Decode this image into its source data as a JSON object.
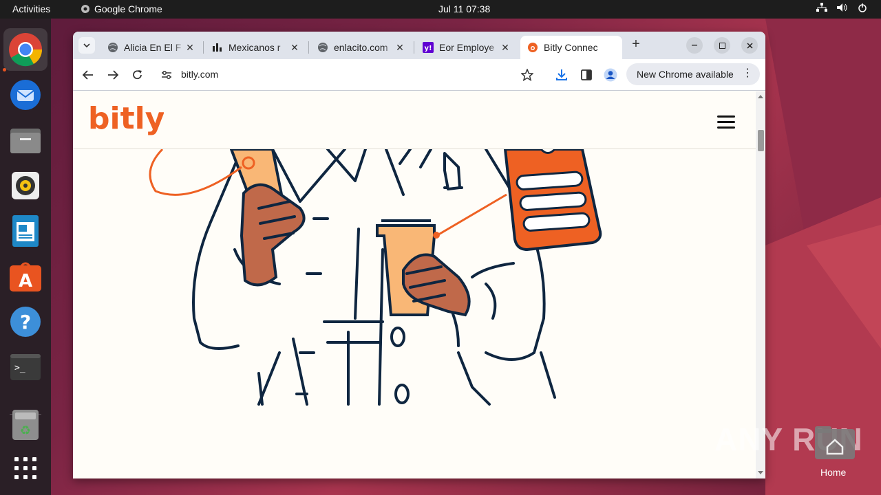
{
  "topbar": {
    "activities": "Activities",
    "app_name": "Google Chrome",
    "clock": "Jul 11  07:38"
  },
  "dock": {
    "items": [
      "chrome-icon",
      "thunderbird-icon",
      "files-icon",
      "rhythmbox-icon",
      "writer-icon",
      "app-center-icon",
      "help-icon",
      "terminal-icon",
      "trash-icon",
      "app-grid-icon"
    ]
  },
  "browser": {
    "tabs": [
      {
        "title": "Alicia En El F",
        "favicon": "globe-icon"
      },
      {
        "title": "Mexicanos r",
        "favicon": "site-icon"
      },
      {
        "title": "enlacito.com",
        "favicon": "globe-icon"
      },
      {
        "title": "Eor Employe",
        "favicon": "yahoo-icon"
      },
      {
        "title": "Bitly Connec",
        "favicon": "bitly-icon",
        "active": true
      }
    ],
    "url": "bitly.com",
    "update_label": "New Chrome available"
  },
  "page": {
    "logo_text": "bitly",
    "brand_color": "#ee6123"
  },
  "desktop": {
    "home_label": "Home",
    "watermark": "ANY RUN"
  }
}
